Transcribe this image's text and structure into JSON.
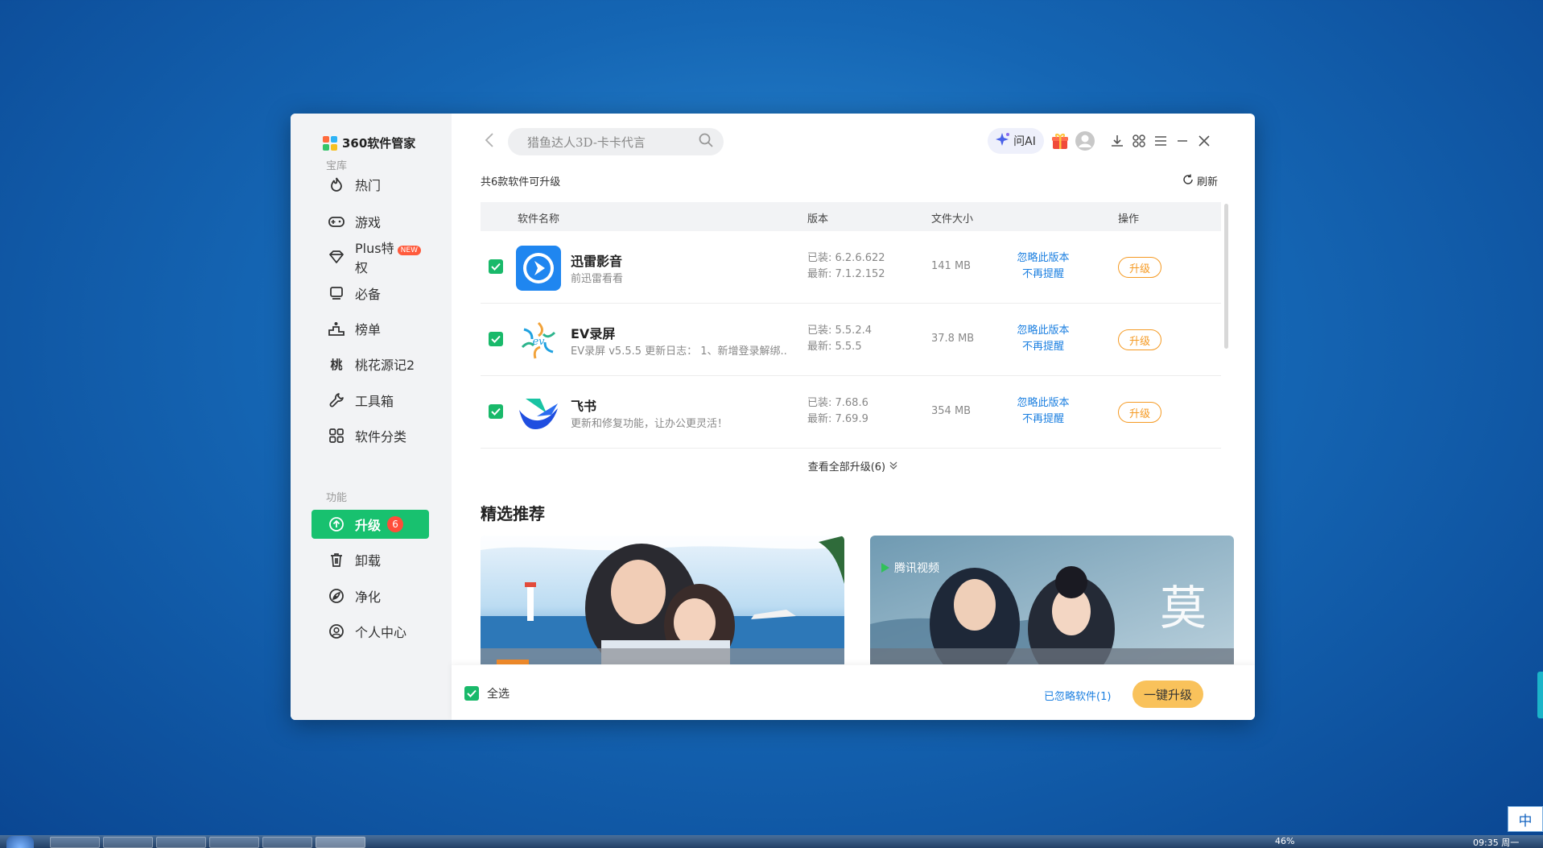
{
  "app": {
    "title": "360软件管家"
  },
  "sidebar": {
    "section_library": "宝库",
    "section_functions": "功能",
    "items": [
      {
        "label": "热门",
        "icon": "fire-icon"
      },
      {
        "label": "游戏",
        "icon": "gamepad-icon"
      },
      {
        "label": "Plus特权",
        "icon": "diamond-icon",
        "badge": "NEW"
      },
      {
        "label": "必备",
        "icon": "monitor-icon"
      },
      {
        "label": "榜单",
        "icon": "podium-icon"
      },
      {
        "label": "桃花源记2",
        "icon": "peach-icon"
      },
      {
        "label": "工具箱",
        "icon": "wrench-icon"
      },
      {
        "label": "软件分类",
        "icon": "grid-icon"
      }
    ],
    "function_items": [
      {
        "label": "升级",
        "icon": "upgrade-icon",
        "count": "6",
        "active": true
      },
      {
        "label": "卸载",
        "icon": "trash-icon"
      },
      {
        "label": "净化",
        "icon": "purify-icon"
      },
      {
        "label": "个人中心",
        "icon": "user-circle-icon"
      }
    ]
  },
  "header": {
    "search_placeholder": "猎鱼达人3D-卡卡代言",
    "ai_label": "问AI"
  },
  "updates": {
    "count_text": "共6款软件可升级",
    "refresh_label": "刷新",
    "columns": {
      "name": "软件名称",
      "version": "版本",
      "size": "文件大小",
      "action": "操作"
    },
    "rows": [
      {
        "name": "迅雷影音",
        "desc": "前迅雷看看",
        "installed": "已装: 6.2.6.622",
        "latest": "最新: 7.1.2.152",
        "size": "141 MB",
        "ignore_version": "忽略此版本",
        "no_remind": "不再提醒",
        "upgrade": "升级",
        "checked": true
      },
      {
        "name": "EV录屏",
        "desc": "EV录屏 v5.5.5 更新日志： 1、新增登录解绑...",
        "installed": "已装: 5.5.2.4",
        "latest": "最新: 5.5.5",
        "size": "37.8 MB",
        "ignore_version": "忽略此版本",
        "no_remind": "不再提醒",
        "upgrade": "升级",
        "checked": true
      },
      {
        "name": "飞书",
        "desc": "更新和修复功能，让办公更灵活！",
        "installed": "已装: 7.68.6",
        "latest": "最新: 7.69.9",
        "size": "354 MB",
        "ignore_version": "忽略此版本",
        "no_remind": "不再提醒",
        "upgrade": "升级",
        "checked": true
      }
    ],
    "see_all": "查看全部升级(6)"
  },
  "recommend": {
    "title": "精选推荐",
    "banner_right_brand": "腾讯视频",
    "banner_right_glyph": "莫"
  },
  "footer": {
    "select_all": "全选",
    "ignored": "已忽略软件(1)",
    "one_key": "一键升级"
  },
  "taskbar": {
    "battery": "46%",
    "clock": "09:35 周一",
    "ime": "中"
  },
  "colors": {
    "accent_green": "#18c16f",
    "upgrade_orange": "#f59a23",
    "link_blue": "#1b7fe0",
    "one_key_yellow": "#f9c25b"
  }
}
